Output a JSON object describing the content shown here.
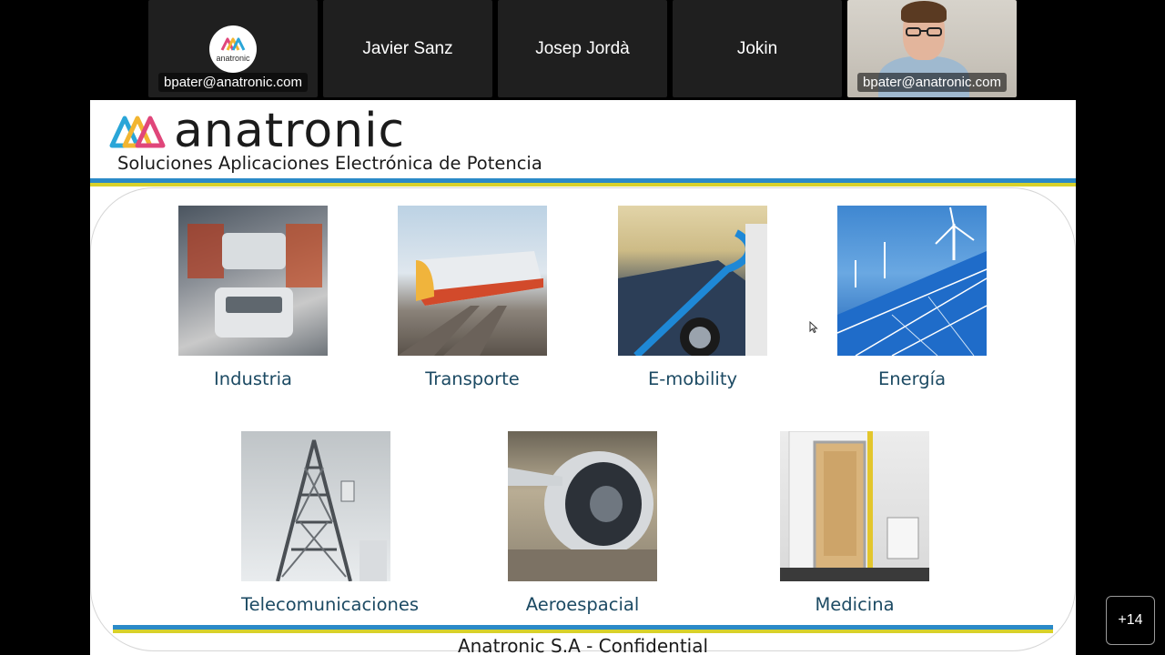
{
  "participants": [
    {
      "type": "avatar",
      "email": "bpater@anatronic.com",
      "avatar_text": "anatronic"
    },
    {
      "type": "name",
      "name": "Javier Sanz"
    },
    {
      "type": "name",
      "name": "Josep Jordà"
    },
    {
      "type": "name",
      "name": "Jokin"
    },
    {
      "type": "video",
      "email": "bpater@anatronic.com"
    }
  ],
  "slide": {
    "brand": "anatronic",
    "tagline": "Soluciones Aplicaciones Electrónica de Potencia",
    "sectors": [
      {
        "label": "Industria",
        "icon": "factory-robots-image"
      },
      {
        "label": "Transporte",
        "icon": "train-image"
      },
      {
        "label": "E-mobility",
        "icon": "ev-charging-image"
      },
      {
        "label": "Energía",
        "icon": "solar-wind-image"
      },
      {
        "label": "Telecomunicaciones",
        "icon": "telecom-tower-image"
      },
      {
        "label": "Aeroespacial",
        "icon": "jet-engine-image"
      },
      {
        "label": "Medicina",
        "icon": "medical-chamber-image"
      }
    ],
    "footer": "Anatronic S.A - Confidential",
    "colors": {
      "stripe_blue": "#2b8ac8",
      "stripe_yellow": "#d8d12a",
      "label": "#1c4a63"
    }
  },
  "controls": {
    "more_participants": "+14"
  }
}
